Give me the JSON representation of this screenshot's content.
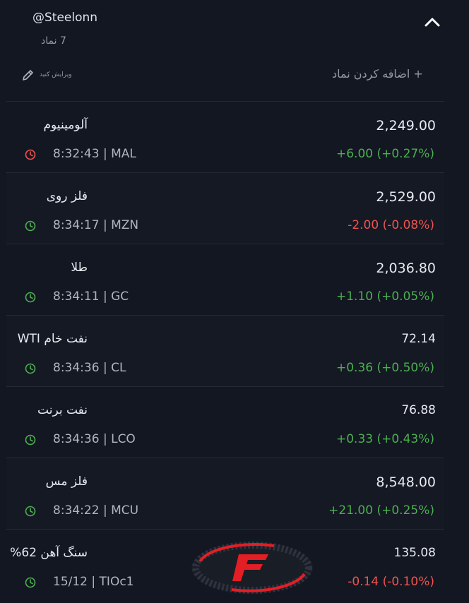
{
  "header": {
    "username": "@Steelonn",
    "symbol_count": "7 نماد",
    "edit_label": "ویرایش کنید",
    "add_symbol_label": "+ اضافه کردن نماد"
  },
  "colors": {
    "background": "#131722",
    "positive": "#4caf50",
    "negative": "#ef5350",
    "clock_alert": "#ef5350",
    "clock_normal": "#4caf50",
    "logo_red": "#e31e24"
  },
  "icons": [
    "chevron-up-icon",
    "pencil-icon",
    "clock-icon"
  ],
  "rows": [
    {
      "name": "آلومینیوم",
      "price": "2,249.00",
      "time": "8:32:43",
      "ticker": "MAL",
      "change": "+6.00 (+0.27%)",
      "direction": "up",
      "clock": "alert"
    },
    {
      "name": "فلز روی",
      "price": "2,529.00",
      "time": "8:34:17",
      "ticker": "MZN",
      "change": "-2.00 (-0.08%)",
      "direction": "down",
      "clock": "normal"
    },
    {
      "name": "طلا",
      "price": "2,036.80",
      "time": "8:34:11",
      "ticker": "GC",
      "change": "+1.10 (+0.05%)",
      "direction": "up",
      "clock": "normal"
    },
    {
      "name": "نفت خام WTI",
      "price": "72.14",
      "time": "8:34:36",
      "ticker": "CL",
      "change": "+0.36 (+0.50%)",
      "direction": "up",
      "clock": "normal"
    },
    {
      "name": "نفت برنت",
      "price": "76.88",
      "time": "8:34:36",
      "ticker": "LCO",
      "change": "+0.33 (+0.43%)",
      "direction": "up",
      "clock": "normal"
    },
    {
      "name": "فلز مس",
      "price": "8,548.00",
      "time": "8:34:22",
      "ticker": "MCU",
      "change": "+21.00 (+0.25%)",
      "direction": "up",
      "clock": "normal"
    },
    {
      "name": "سنگ آهن 62%",
      "price": "135.08",
      "time": "15/12",
      "ticker": "TIOc1",
      "change": "-0.14 (-0.10%)",
      "direction": "down",
      "clock": "normal"
    }
  ]
}
